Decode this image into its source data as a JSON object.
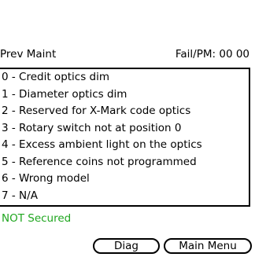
{
  "header": {
    "left_label": "Prev Maint",
    "right_label": "Fail/PM: 00 00"
  },
  "list": {
    "items": [
      "0 - Credit optics dim",
      "1 - Diameter optics dim",
      "2 - Reserved for X-Mark code optics",
      "3 - Rotary switch not at position 0",
      "4 - Excess ambient light on the optics",
      "5 - Reference coins not programmed",
      "6 - Wrong model",
      "7 - N/A"
    ]
  },
  "status": {
    "text": "NOT Secured",
    "color": "#1fa61f"
  },
  "buttons": {
    "diag_label": "Diag",
    "main_menu_label": "Main Menu"
  }
}
